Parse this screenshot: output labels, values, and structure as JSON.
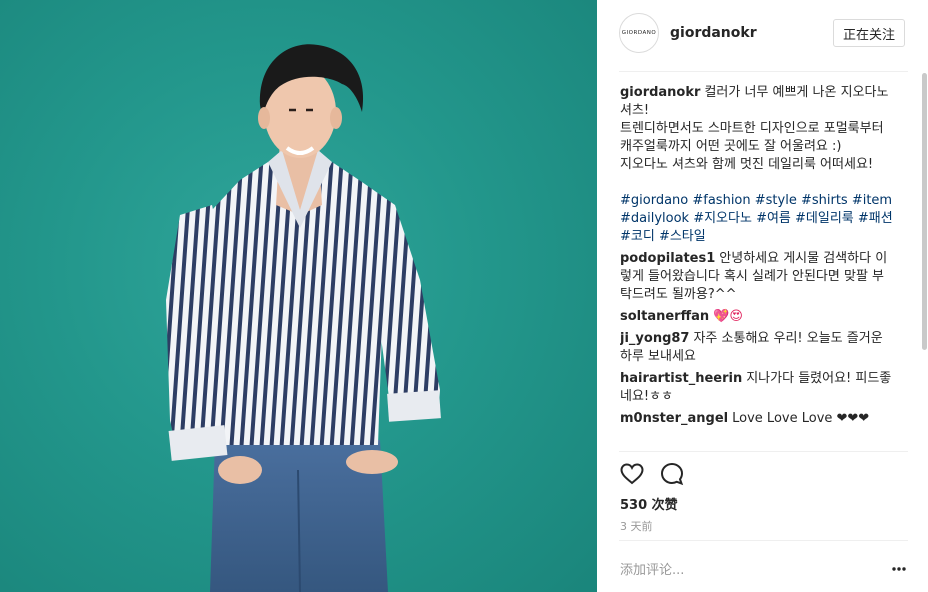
{
  "colors": {
    "photo_bg": "#23978c",
    "tag_link": "#003569",
    "follow_border": "#dbdbdb"
  },
  "header": {
    "avatar_text": "GIORDANO",
    "username": "giordanokr",
    "follow_label": "正在关注"
  },
  "caption": {
    "user": "giordanokr",
    "lines": [
      "컬러가 너무 예쁘게 나온 지오다노 셔츠!",
      "트렌디하면서도 스마트한 디자인으로 포멀룩부터 캐주얼룩까지 어떤 곳에도 잘 어울려요 :)",
      "지오다노 셔츠와 함께 멋진 데일리룩 어떠세요!"
    ],
    "hashtags": "#giordano #fashion #style #shirts #item #dailylook #지오다노 #여름 #데일리룩 #패션 #코디 #스타일"
  },
  "comments": [
    {
      "user": "podopilates1",
      "text": "안녕하세요 게시물 검색하다 이렇게 들어왔습니다 혹시 실례가 안된다면 맞팔 부탁드려도 될까용?^^"
    },
    {
      "user": "soltanerffan",
      "text": "💖😍"
    },
    {
      "user": "ji_yong87",
      "text": "자주 소통해요 우리! 오늘도 즐거운 하루 보내세요"
    },
    {
      "user": "hairartist_heerin",
      "text": "지나가다 들렸어요! 피드좋네요!ㅎㅎ"
    },
    {
      "user": "m0nster_angel",
      "text": "Love Love Love ❤❤❤"
    }
  ],
  "actions": {
    "like_icon": "heart-outline-icon",
    "comment_icon": "comment-bubble-icon",
    "likes": "530 次赞",
    "time": "3 天前"
  },
  "add_comment": {
    "placeholder": "添加评论...",
    "more_icon": "more-options-icon"
  }
}
